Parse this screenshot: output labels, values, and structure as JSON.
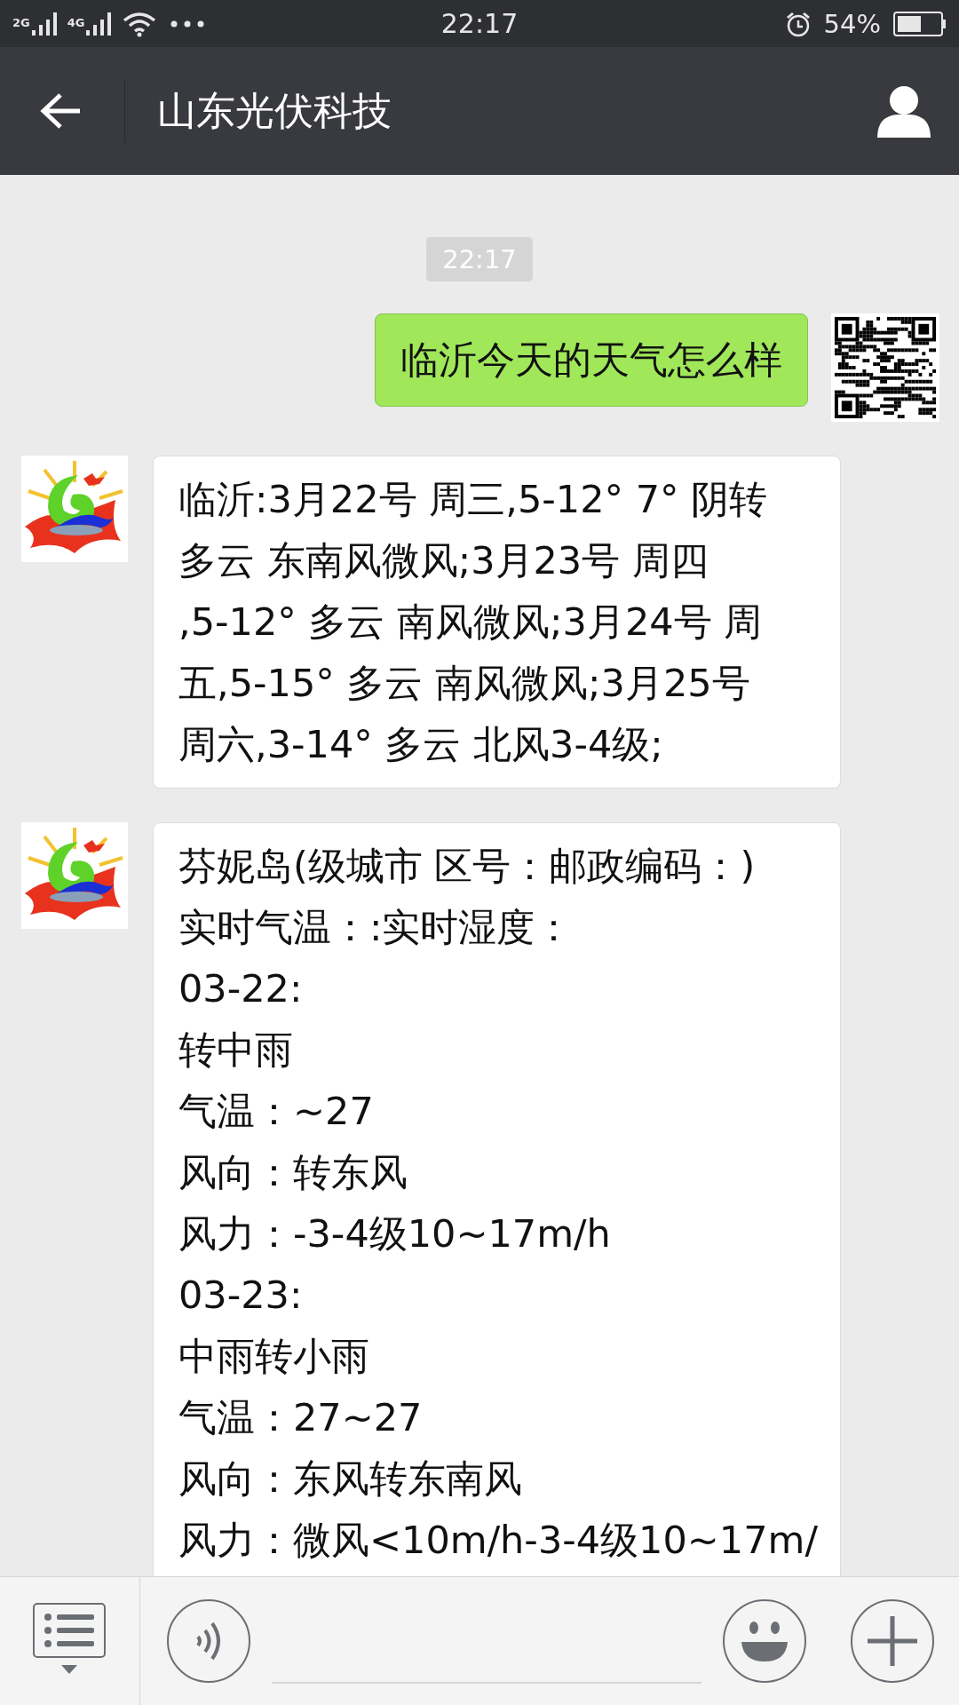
{
  "status_bar": {
    "signals": [
      "2G",
      "4G"
    ],
    "time": "22:17",
    "battery": "54%"
  },
  "header": {
    "title": "山东光伏科技"
  },
  "messages": [
    {
      "kind": "time",
      "text": "22:17"
    },
    {
      "kind": "sent",
      "lines": [
        "临沂今天的天气怎么样"
      ]
    },
    {
      "kind": "received",
      "lines": [
        "临沂:3月22号 周三,5-12° 7° 阴转",
        "多云 东南风微风;3月23号 周四",
        ",5-12° 多云 南风微风;3月24号 周",
        "五,5-15° 多云 南风微风;3月25号",
        "周六,3-14° 多云 北风3-4级;"
      ]
    },
    {
      "kind": "received",
      "lines": [
        "芬妮岛(级城市 区号：邮政编码：)",
        "实时气温：:实时湿度：",
        "03-22:",
        "转中雨",
        "气温：~27",
        "风向：转东风",
        "风力：-3-4级10~17m/h",
        "03-23:",
        "中雨转小雨",
        "气温：27~27",
        "风向：东风转东南风",
        "风力：微风<10m/h-3-4级10~17m/"
      ]
    }
  ]
}
